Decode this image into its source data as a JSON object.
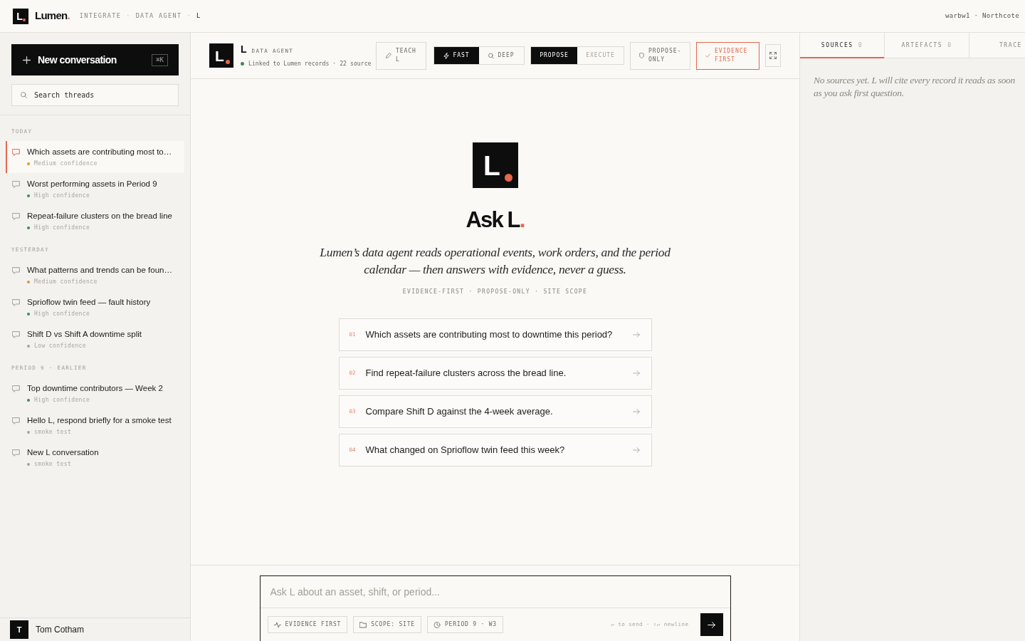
{
  "topbar": {
    "logo_mark": "L",
    "brand": "Lumen",
    "brand_mark": ".",
    "breadcrumb": [
      {
        "label": "INTEGRATE",
        "current": false
      },
      {
        "label": "DATA AGENT",
        "current": false
      },
      {
        "label": "L",
        "current": true
      }
    ],
    "separator": "·",
    "workspace": "warbw1 · Northcote"
  },
  "sidebar": {
    "new_button": {
      "label": "New conversation",
      "shortcut": "⌘K"
    },
    "search": {
      "placeholder": "Search threads"
    },
    "groups": [
      {
        "label": "TODAY",
        "threads": [
          {
            "title": "Which assets are contributing most to…",
            "meta": "Medium confidence",
            "color": "#d99a2b",
            "selected": true
          },
          {
            "title": "Worst performing assets in Period 9",
            "meta": "High confidence",
            "color": "#3d8b55",
            "selected": false
          },
          {
            "title": "Repeat-failure clusters on the bread line",
            "meta": "High confidence",
            "color": "#3d8b55",
            "selected": false
          }
        ]
      },
      {
        "label": "YESTERDAY",
        "threads": [
          {
            "title": "What patterns and trends can be foun…",
            "meta": "Medium confidence",
            "color": "#d99a2b",
            "selected": false
          },
          {
            "title": "Sprioflow twin feed — fault history",
            "meta": "High confidence",
            "color": "#3d8b55",
            "selected": false
          },
          {
            "title": "Shift D vs Shift A downtime split",
            "meta": "Low confidence",
            "color": "#a8a59e",
            "selected": false
          }
        ]
      },
      {
        "label": "PERIOD 9 · EARLIER",
        "threads": [
          {
            "title": "Top downtime contributors — Week 2",
            "meta": "High confidence",
            "color": "#3d8b55",
            "selected": false
          },
          {
            "title": "Hello L, respond briefly for a smoke test",
            "meta": "smoke test",
            "color": "#a8a59e",
            "selected": false
          },
          {
            "title": "New L conversation",
            "meta": "smoke test",
            "color": "#a8a59e",
            "selected": false
          }
        ]
      }
    ],
    "user": {
      "initial": "T",
      "name": "Tom Cotham"
    }
  },
  "header": {
    "avatar": "L",
    "name": "L",
    "role": "DATA AGENT",
    "linked": true,
    "status": "Linked to Lumen records · 22 source",
    "teach": "TEACH L",
    "speed": [
      {
        "label": "FAST",
        "selected": true
      },
      {
        "label": "DEEP",
        "selected": false
      }
    ],
    "action": [
      {
        "label": "PROPOSE",
        "selected": true,
        "disabled": false
      },
      {
        "label": "EXECUTE",
        "selected": false,
        "disabled": true
      }
    ],
    "toggles": [
      {
        "label": "PROPOSE-ONLY",
        "on": false
      },
      {
        "label": "EVIDENCE FIRST",
        "on": true
      }
    ]
  },
  "main": {
    "logo_mark": "L",
    "title": "Ask L",
    "title_mark": ".",
    "intro": "Lumen’s data agent reads operational events, work orders, and the period calendar — then answers with evidence, never a guess.",
    "tags": "EVIDENCE-FIRST · PROPOSE-ONLY · SITE SCOPE",
    "suggestions": [
      {
        "number": "01",
        "text": "Which assets are contributing most to downtime this period?"
      },
      {
        "number": "02",
        "text": "Find repeat-failure clusters across the bread line."
      },
      {
        "number": "03",
        "text": "Compare Shift D against the 4-week average."
      },
      {
        "number": "04",
        "text": "What changed on Sprioflow twin feed this week?"
      }
    ]
  },
  "composer": {
    "placeholder": "Ask L about an asset, shift, or period...",
    "chips": [
      {
        "label": "EVIDENCE FIRST"
      },
      {
        "label": "SCOPE: SITE"
      },
      {
        "label": "PERIOD 9 · W3"
      }
    ],
    "hint": "↵ to send · ⇧↵ newline"
  },
  "side_panel": {
    "tabs": [
      {
        "label": "SOURCES",
        "count": "0",
        "selected": true
      },
      {
        "label": "ARTEFACTS",
        "count": "0",
        "selected": false
      },
      {
        "label": "TRACE",
        "selected": false
      }
    ],
    "empty_text": "No sources yet. L will cite every record it reads as soon as you ask first question."
  }
}
